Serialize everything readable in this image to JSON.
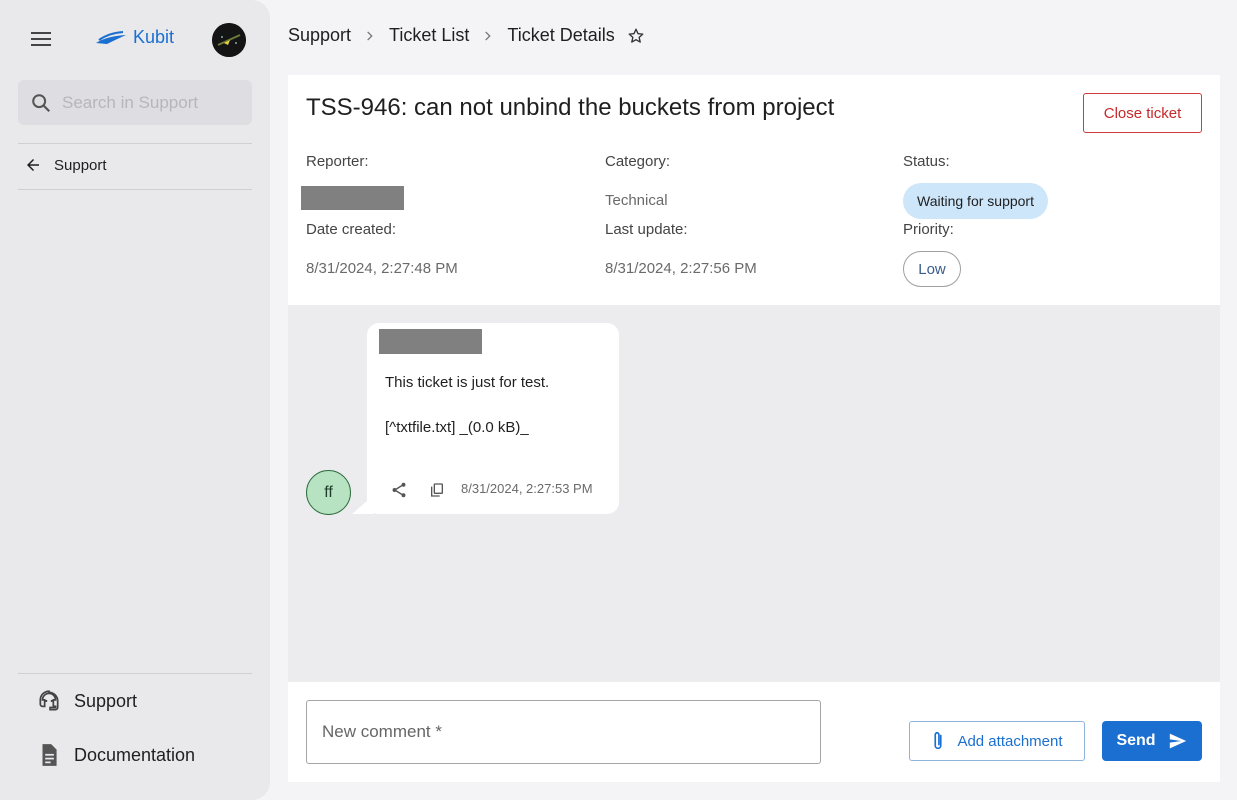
{
  "sidebar": {
    "logo_text": "Kubit",
    "search_placeholder": "Search in Support",
    "back_label": "Support",
    "nav": [
      {
        "label": "Support",
        "icon": "support-agent-icon"
      },
      {
        "label": "Documentation",
        "icon": "document-icon"
      }
    ]
  },
  "breadcrumb": [
    "Support",
    "Ticket List",
    "Ticket Details"
  ],
  "ticket": {
    "title": "TSS-946: can not unbind the buckets from project",
    "close_label": "Close ticket",
    "reporter_label": "Reporter:",
    "category_label": "Category:",
    "category_value": "Technical",
    "status_label": "Status:",
    "status_value": "Waiting for support",
    "date_created_label": "Date created:",
    "date_created_value": "8/31/2024, 2:27:48 PM",
    "last_update_label": "Last update:",
    "last_update_value": "8/31/2024, 2:27:56 PM",
    "priority_label": "Priority:",
    "priority_value": "Low"
  },
  "message": {
    "avatar_initials": "ff",
    "line1": "This ticket is just for test.",
    "line2": "[^txtfile.txt] _(0.0 kB)_",
    "timestamp": "8/31/2024, 2:27:53 PM"
  },
  "composer": {
    "placeholder": "New comment *",
    "attach_label": "Add attachment",
    "send_label": "Send"
  },
  "colors": {
    "accent": "#1a6fd1",
    "danger": "#c62828",
    "status_chip": "#cde6f9",
    "avatar_bg": "#b7e3c3"
  }
}
